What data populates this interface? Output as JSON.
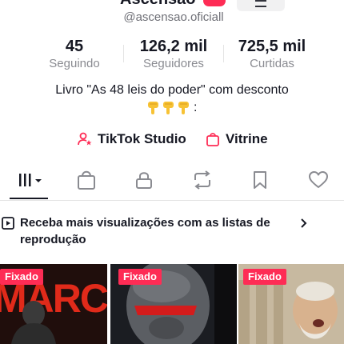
{
  "profile": {
    "name": "Ascensao",
    "handle": "@ascensao.oficiall"
  },
  "stats": [
    {
      "value": "45",
      "label": "Seguindo"
    },
    {
      "value": "126,2 mil",
      "label": "Seguidores"
    },
    {
      "value": "725,5 mil",
      "label": "Curtidas"
    }
  ],
  "bio": {
    "line1": "Livro \"As 48 leis do poder\"  com desconto",
    "emoji_count": 3,
    "line2_suffix": ":"
  },
  "links": {
    "studio": "TikTok Studio",
    "showcase": "Vitrine"
  },
  "tabs": [
    "videos-grid",
    "shopping-bag",
    "lock",
    "repost",
    "bookmark",
    "heart"
  ],
  "playlist_banner": {
    "text": "Receba mais visualizações com as listas de reprodução"
  },
  "videos": [
    {
      "badge": "Fixado",
      "overlay": "MARCO"
    },
    {
      "badge": "Fixado"
    },
    {
      "badge": "Fixado"
    }
  ],
  "colors": {
    "accent": "#fe2c55",
    "text": "#161823",
    "muted": "#8a8b91"
  }
}
